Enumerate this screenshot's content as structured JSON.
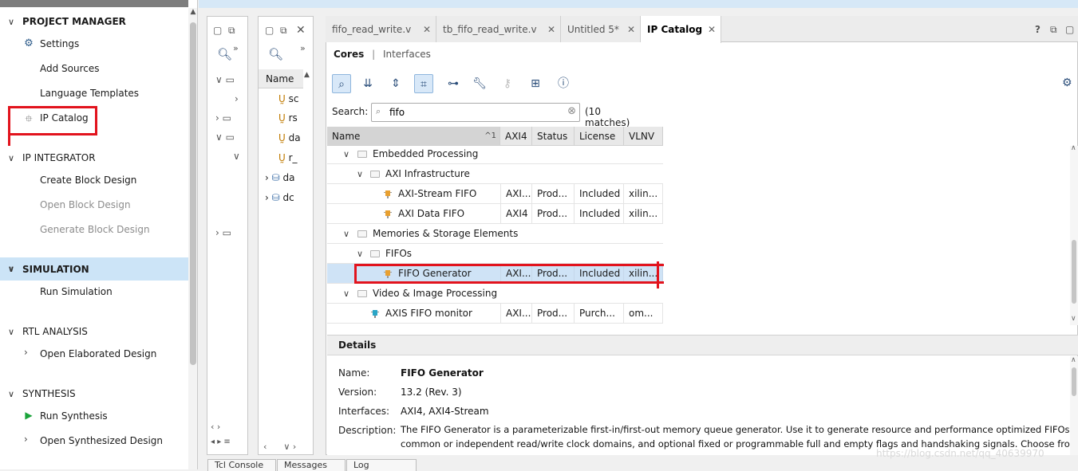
{
  "flow_navigator": {
    "sections": {
      "project_manager": "PROJECT MANAGER",
      "ip_integrator": "IP INTEGRATOR",
      "simulation": "SIMULATION",
      "rtl_analysis": "RTL ANALYSIS",
      "synthesis": "SYNTHESIS"
    },
    "items": {
      "settings": "Settings",
      "add_sources": "Add Sources",
      "language_templates": "Language Templates",
      "ip_catalog": "IP Catalog",
      "create_block_design": "Create Block Design",
      "open_block_design": "Open Block Design",
      "generate_block_design": "Generate Block Design",
      "run_simulation": "Run Simulation",
      "open_elaborated_design": "Open Elaborated Design",
      "run_synthesis": "Run Synthesis",
      "open_synthesized_design": "Open Synthesized Design"
    }
  },
  "sources": {
    "column_name": "Name",
    "files": [
      "sc",
      "rs",
      "da",
      "r_",
      "da",
      "dc"
    ]
  },
  "tabs": [
    {
      "label": "fifo_read_write.v",
      "active": false
    },
    {
      "label": "tb_fifo_read_write.v",
      "active": false
    },
    {
      "label": "Untitled 5*",
      "active": false
    },
    {
      "label": "IP Catalog",
      "active": true
    }
  ],
  "subtabs": {
    "cores": "Cores",
    "interfaces": "Interfaces"
  },
  "search": {
    "label": "Search:",
    "value": "fifo",
    "matches": "(10 matches)"
  },
  "table": {
    "columns": [
      "Name",
      "AXI4",
      "Status",
      "License",
      "VLNV"
    ],
    "sort_indicator": "^1",
    "rows": [
      {
        "name": "Embedded Processing",
        "kind": "folder",
        "level": 1
      },
      {
        "name": "AXI Infrastructure",
        "kind": "folder",
        "level": 2
      },
      {
        "name": "AXI-Stream FIFO",
        "kind": "ip",
        "level": 3,
        "axi4": "AXI...",
        "status": "Prod...",
        "license": "Included",
        "vlnv": "xilin..."
      },
      {
        "name": "AXI Data FIFO",
        "kind": "ip",
        "level": 3,
        "axi4": "AXI4",
        "status": "Prod...",
        "license": "Included",
        "vlnv": "xilin..."
      },
      {
        "name": "Memories & Storage Elements",
        "kind": "folder",
        "level": 1
      },
      {
        "name": "FIFOs",
        "kind": "folder",
        "level": 2
      },
      {
        "name": "FIFO Generator",
        "kind": "ip",
        "level": 3,
        "selected": true,
        "axi4": "AXI...",
        "status": "Prod...",
        "license": "Included",
        "vlnv": "xilin..."
      },
      {
        "name": "Video & Image Processing",
        "kind": "folder",
        "level": 1
      },
      {
        "name": "AXIS FIFO monitor",
        "kind": "ip-alt",
        "level": 2,
        "axi4": "AXI...",
        "status": "Prod...",
        "license": "Purch...",
        "vlnv": "om..."
      }
    ]
  },
  "details": {
    "header": "Details",
    "name_label": "Name:",
    "name": "FIFO Generator",
    "version_label": "Version:",
    "version": "13.2 (Rev. 3)",
    "interfaces_label": "Interfaces:",
    "interfaces": "AXI4, AXI4-Stream",
    "description_label": "Description:",
    "description_line1": "The FIFO Generator is a parameterizable first-in/first-out memory queue generator. Use it to generate resource and performance optimized FIFOs with",
    "description_line2": "common or independent read/write clock domains, and optional fixed or programmable full and empty flags and handshaking signals.  Choose from a"
  },
  "bottom_tabs": [
    "Tcl Console",
    "Messages",
    "Log"
  ],
  "watermark": "https://blog.csdn.net/qq_40639970",
  "colors": {
    "selection": "#cfe3f6",
    "annotation_red": "#e2131d",
    "active_section": "#cce4f7"
  }
}
